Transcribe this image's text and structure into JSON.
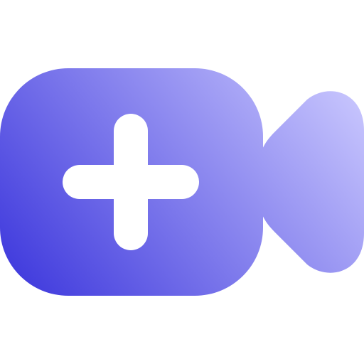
{
  "icon": {
    "name": "add-video-call-icon",
    "colors": {
      "gradient_start": "#2A24D8",
      "gradient_end": "#CECCFF",
      "plus_symbol": "#FFFFFF",
      "background": "#FFFFFF"
    }
  }
}
